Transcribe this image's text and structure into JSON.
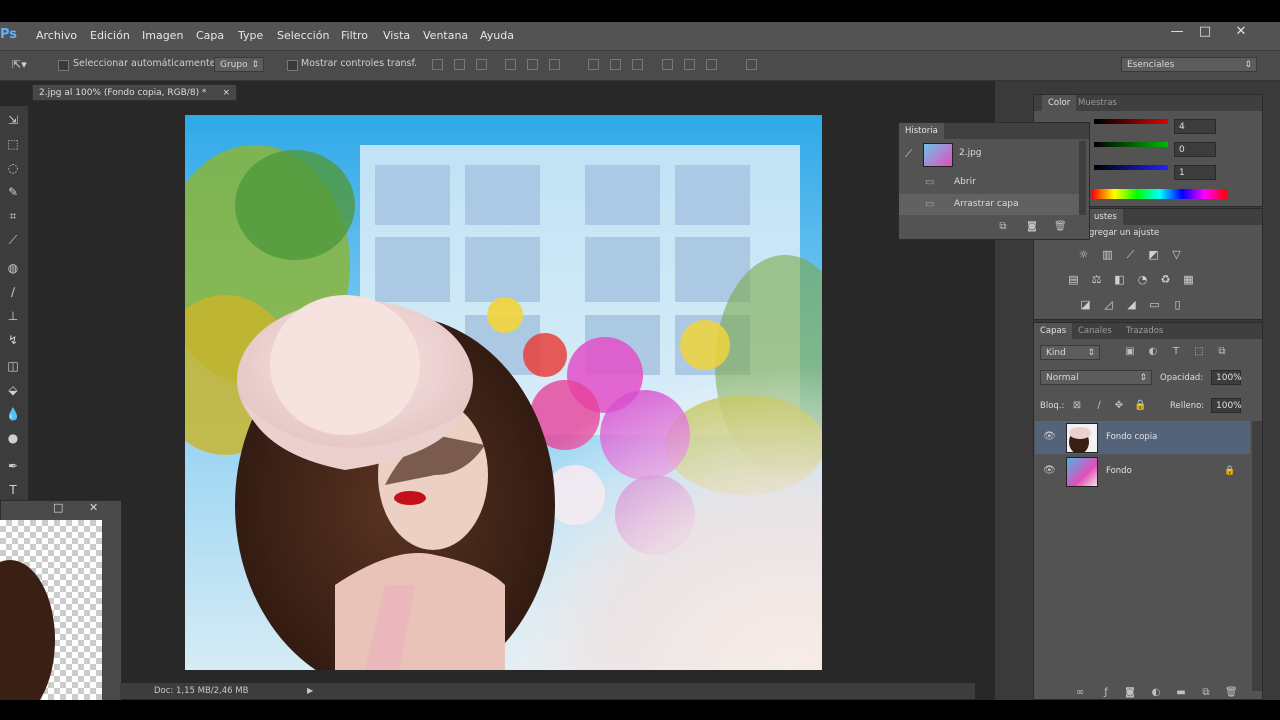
{
  "app": {
    "logo": "Ps",
    "menu": [
      "Archivo",
      "Edición",
      "Imagen",
      "Capa",
      "Type",
      "Selección",
      "Filtro",
      "Vista",
      "Ventana",
      "Ayuda"
    ],
    "window_controls": [
      "—",
      "□",
      "✕"
    ]
  },
  "options_bar": {
    "auto_select_label": "Seleccionar automáticamente:",
    "auto_select_value": "Grupo",
    "show_transform_label": "Mostrar controles transf.",
    "workspace": "Esenciales"
  },
  "document": {
    "tab_label": "2.jpg al 100% (Fondo copia, RGB/8) *",
    "status": "Doc: 1,15 MB/2,46 MB"
  },
  "color_panel": {
    "tabs": [
      "Color",
      "Muestras"
    ],
    "values": [
      "4",
      "0",
      "1"
    ]
  },
  "history_panel": {
    "title": "Historia",
    "snapshot": "2.jpg",
    "items": [
      "Abrir",
      "Arrastrar capa"
    ]
  },
  "adjustments_panel": {
    "title_fragment": "ustes",
    "subtitle_fragment": "gregar un ajuste"
  },
  "layers_panel": {
    "tabs": [
      "Capas",
      "Canales",
      "Trazados"
    ],
    "filter_kind": "Kind",
    "blend_mode": "Normal",
    "opacity_label": "Opacidad:",
    "opacity_value": "100%",
    "lock_label": "Bloq.:",
    "fill_label": "Relleno:",
    "fill_value": "100%",
    "layers": [
      {
        "name": "Fondo copia",
        "selected": true
      },
      {
        "name": "Fondo",
        "locked": true
      }
    ]
  },
  "colors": {
    "menubar": "#535353",
    "workspace": "#282828",
    "panel": "#535353",
    "selection": "#52637a",
    "accent": "#5fb0ff"
  }
}
